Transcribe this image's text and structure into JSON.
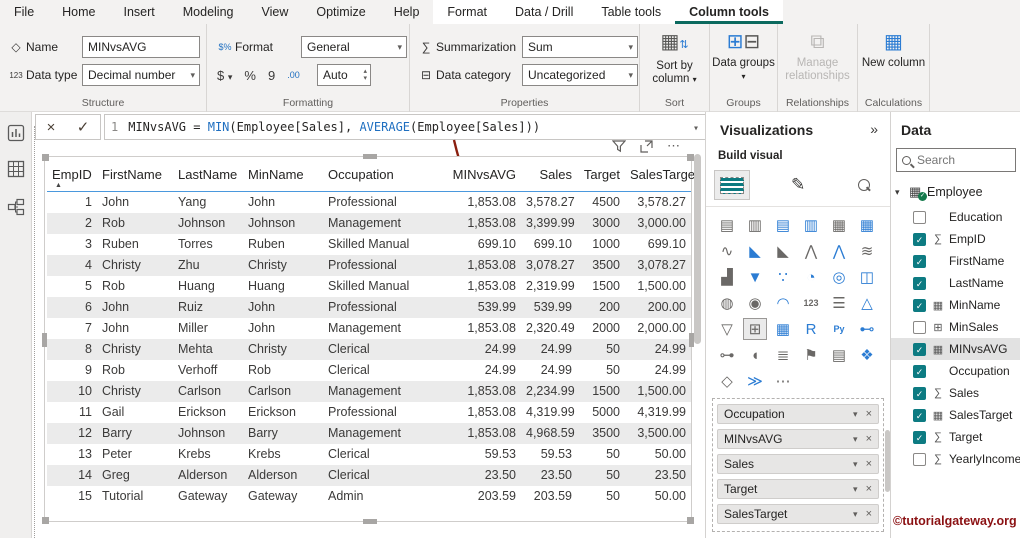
{
  "icons": {
    "chevron_down": "▾",
    "chevron_up": "▴",
    "more": "⋯",
    "double_chevron": "»",
    "check": "✓",
    "close": "×",
    "sort_asc": "▲",
    "tree_chevron": "▾",
    "table_glyph": "▦",
    "name_tag": "◇",
    "datatype_123": "123",
    "format_money": "$%",
    "sigma": "∑",
    "category": "⊟",
    "dollar": "$",
    "percent": "%",
    "thousands": "9",
    "decimals": ".00"
  },
  "menu": {
    "tabs": [
      {
        "dn": "menu-tab-file",
        "label": "File",
        "active": false,
        "ctx": false
      },
      {
        "dn": "menu-tab-home",
        "label": "Home",
        "active": false,
        "ctx": false
      },
      {
        "dn": "menu-tab-insert",
        "label": "Insert",
        "active": false,
        "ctx": false
      },
      {
        "dn": "menu-tab-modeling",
        "label": "Modeling",
        "active": false,
        "ctx": false
      },
      {
        "dn": "menu-tab-view",
        "label": "View",
        "active": false,
        "ctx": false
      },
      {
        "dn": "menu-tab-optimize",
        "label": "Optimize",
        "active": false,
        "ctx": false
      },
      {
        "dn": "menu-tab-help",
        "label": "Help",
        "active": false,
        "ctx": false
      },
      {
        "dn": "menu-tab-format",
        "label": "Format",
        "active": false,
        "ctx": true
      },
      {
        "dn": "menu-tab-data-drill",
        "label": "Data / Drill",
        "active": false,
        "ctx": true
      },
      {
        "dn": "menu-tab-table-tools",
        "label": "Table tools",
        "active": false,
        "ctx": true
      },
      {
        "dn": "menu-tab-column-tools",
        "label": "Column tools",
        "active": true,
        "ctx": true
      }
    ]
  },
  "ribbon": {
    "structure": {
      "name_label": "Name",
      "name_value": "MINvsAVG",
      "datatype_label": "Data type",
      "datatype_value": "Decimal number",
      "group_label": "Structure"
    },
    "formatting": {
      "format_label": "Format",
      "format_value": "General",
      "auto_value": "Auto",
      "group_label": "Formatting"
    },
    "properties": {
      "summarization_label": "Summarization",
      "summarization_value": "Sum",
      "category_label": "Data category",
      "category_value": "Uncategorized",
      "group_label": "Properties"
    },
    "sort": {
      "button_label": "Sort by column",
      "group_label": "Sort"
    },
    "groups": {
      "button_label": "Data groups",
      "group_label": "Groups"
    },
    "relationships": {
      "button_label": "Manage relationships",
      "group_label": "Relationships"
    },
    "calculations": {
      "button_label": "New column",
      "group_label": "Calculations"
    }
  },
  "formula_bar": {
    "line_number": "1",
    "tokens": [
      {
        "text": "MINvsAVG = ",
        "func": false
      },
      {
        "text": "MIN",
        "func": true
      },
      {
        "text": "(Employee[Sales], ",
        "func": false
      },
      {
        "text": "AVERAGE",
        "func": true
      },
      {
        "text": "(Employee[Sales]))",
        "func": false
      }
    ]
  },
  "table": {
    "columns": [
      {
        "dn": "column-header-empid",
        "label": "EmpID",
        "right": false,
        "sorted": true
      },
      {
        "dn": "column-header-firstname",
        "label": "FirstName",
        "right": false,
        "sorted": false
      },
      {
        "dn": "column-header-lastname",
        "label": "LastName",
        "right": false,
        "sorted": false
      },
      {
        "dn": "column-header-minname",
        "label": "MinName",
        "right": false,
        "sorted": false
      },
      {
        "dn": "column-header-occupation",
        "label": "Occupation",
        "right": false,
        "sorted": false
      },
      {
        "dn": "column-header-minvsavg",
        "label": "MINvsAVG",
        "right": true,
        "sorted": false
      },
      {
        "dn": "column-header-sales",
        "label": "Sales",
        "right": true,
        "sorted": false
      },
      {
        "dn": "column-header-target",
        "label": "Target",
        "right": true,
        "sorted": false
      },
      {
        "dn": "column-header-salestarget",
        "label": "SalesTarget",
        "right": true,
        "sorted": false
      }
    ],
    "rows": [
      {
        "empid": "1",
        "first": "John",
        "last": "Yang",
        "minname": "John",
        "occ": "Professional",
        "minvsavg": "1,853.08",
        "sales": "3,578.27",
        "target": "4500",
        "salestarget": "3,578.27"
      },
      {
        "empid": "2",
        "first": "Rob",
        "last": "Johnson",
        "minname": "Johnson",
        "occ": "Management",
        "minvsavg": "1,853.08",
        "sales": "3,399.99",
        "target": "3000",
        "salestarget": "3,000.00"
      },
      {
        "empid": "3",
        "first": "Ruben",
        "last": "Torres",
        "minname": "Ruben",
        "occ": "Skilled Manual",
        "minvsavg": "699.10",
        "sales": "699.10",
        "target": "1000",
        "salestarget": "699.10"
      },
      {
        "empid": "4",
        "first": "Christy",
        "last": "Zhu",
        "minname": "Christy",
        "occ": "Professional",
        "minvsavg": "1,853.08",
        "sales": "3,078.27",
        "target": "3500",
        "salestarget": "3,078.27"
      },
      {
        "empid": "5",
        "first": "Rob",
        "last": "Huang",
        "minname": "Huang",
        "occ": "Skilled Manual",
        "minvsavg": "1,853.08",
        "sales": "2,319.99",
        "target": "1500",
        "salestarget": "1,500.00"
      },
      {
        "empid": "6",
        "first": "John",
        "last": "Ruiz",
        "minname": "John",
        "occ": "Professional",
        "minvsavg": "539.99",
        "sales": "539.99",
        "target": "200",
        "salestarget": "200.00"
      },
      {
        "empid": "7",
        "first": "John",
        "last": "Miller",
        "minname": "John",
        "occ": "Management",
        "minvsavg": "1,853.08",
        "sales": "2,320.49",
        "target": "2000",
        "salestarget": "2,000.00"
      },
      {
        "empid": "8",
        "first": "Christy",
        "last": "Mehta",
        "minname": "Christy",
        "occ": "Clerical",
        "minvsavg": "24.99",
        "sales": "24.99",
        "target": "50",
        "salestarget": "24.99"
      },
      {
        "empid": "9",
        "first": "Rob",
        "last": "Verhoff",
        "minname": "Rob",
        "occ": "Clerical",
        "minvsavg": "24.99",
        "sales": "24.99",
        "target": "50",
        "salestarget": "24.99"
      },
      {
        "empid": "10",
        "first": "Christy",
        "last": "Carlson",
        "minname": "Carlson",
        "occ": "Management",
        "minvsavg": "1,853.08",
        "sales": "2,234.99",
        "target": "1500",
        "salestarget": "1,500.00"
      },
      {
        "empid": "11",
        "first": "Gail",
        "last": "Erickson",
        "minname": "Erickson",
        "occ": "Professional",
        "minvsavg": "1,853.08",
        "sales": "4,319.99",
        "target": "5000",
        "salestarget": "4,319.99"
      },
      {
        "empid": "12",
        "first": "Barry",
        "last": "Johnson",
        "minname": "Barry",
        "occ": "Management",
        "minvsavg": "1,853.08",
        "sales": "4,968.59",
        "target": "3500",
        "salestarget": "3,500.00"
      },
      {
        "empid": "13",
        "first": "Peter",
        "last": "Krebs",
        "minname": "Krebs",
        "occ": "Clerical",
        "minvsavg": "59.53",
        "sales": "59.53",
        "target": "50",
        "salestarget": "50.00"
      },
      {
        "empid": "14",
        "first": "Greg",
        "last": "Alderson",
        "minname": "Alderson",
        "occ": "Clerical",
        "minvsavg": "23.50",
        "sales": "23.50",
        "target": "50",
        "salestarget": "23.50"
      },
      {
        "empid": "15",
        "first": "Tutorial",
        "last": "Gateway",
        "minname": "Gateway",
        "occ": "Admin",
        "minvsavg": "203.59",
        "sales": "203.59",
        "target": "50",
        "salestarget": "50.00"
      }
    ]
  },
  "visualizations": {
    "title": "Visualizations",
    "build_label": "Build visual",
    "icons": [
      {
        "dn": "stacked-bar-chart-icon",
        "glyph": "▤",
        "blue": false,
        "sm": false,
        "sel": false
      },
      {
        "dn": "stacked-column-chart-icon",
        "glyph": "▥",
        "blue": false,
        "sm": false,
        "sel": false
      },
      {
        "dn": "clustered-bar-chart-icon",
        "glyph": "▤",
        "blue": true,
        "sm": false,
        "sel": false
      },
      {
        "dn": "clustered-column-chart-icon",
        "glyph": "▥",
        "blue": true,
        "sm": false,
        "sel": false
      },
      {
        "dn": "hundred-stacked-bar-chart-icon",
        "glyph": "▦",
        "blue": false,
        "sm": false,
        "sel": false
      },
      {
        "dn": "hundred-stacked-column-chart-icon",
        "glyph": "▦",
        "blue": true,
        "sm": false,
        "sel": false
      },
      {
        "dn": "line-chart-icon",
        "glyph": "∿",
        "blue": false,
        "sm": false,
        "sel": false
      },
      {
        "dn": "area-chart-icon",
        "glyph": "◣",
        "blue": true,
        "sm": false,
        "sel": false
      },
      {
        "dn": "stacked-area-chart-icon",
        "glyph": "◣",
        "blue": false,
        "sm": false,
        "sel": false
      },
      {
        "dn": "line-and-stacked-column-chart-icon",
        "glyph": "⋀",
        "blue": false,
        "sm": false,
        "sel": false
      },
      {
        "dn": "line-and-clustered-column-chart-icon",
        "glyph": "⋀",
        "blue": true,
        "sm": false,
        "sel": false
      },
      {
        "dn": "ribbon-chart-icon",
        "glyph": "≋",
        "blue": false,
        "sm": false,
        "sel": false
      },
      {
        "dn": "waterfall-chart-icon",
        "glyph": "▟",
        "blue": false,
        "sm": false,
        "sel": false
      },
      {
        "dn": "funnel-chart-icon",
        "glyph": "▼",
        "blue": true,
        "sm": false,
        "sel": false
      },
      {
        "dn": "scatter-chart-icon",
        "glyph": "∵",
        "blue": true,
        "sm": false,
        "sel": false
      },
      {
        "dn": "pie-chart-icon",
        "glyph": "◔",
        "blue": true,
        "sm": false,
        "sel": false
      },
      {
        "dn": "donut-chart-icon",
        "glyph": "◎",
        "blue": true,
        "sm": false,
        "sel": false
      },
      {
        "dn": "treemap-icon",
        "glyph": "◫",
        "blue": true,
        "sm": false,
        "sel": false
      },
      {
        "dn": "map-icon",
        "glyph": "◍",
        "blue": false,
        "sm": false,
        "sel": false
      },
      {
        "dn": "filled-map-icon",
        "glyph": "◉",
        "blue": false,
        "sm": false,
        "sel": false
      },
      {
        "dn": "gauge-icon",
        "glyph": "◠",
        "blue": true,
        "sm": false,
        "sel": false
      },
      {
        "dn": "card-icon",
        "glyph": "123",
        "blue": false,
        "sm": true,
        "sel": false
      },
      {
        "dn": "multi-row-card-icon",
        "glyph": "☰",
        "blue": false,
        "sm": false,
        "sel": false
      },
      {
        "dn": "kpi-icon",
        "glyph": "△",
        "blue": true,
        "sm": false,
        "sel": false
      },
      {
        "dn": "slicer-icon",
        "glyph": "▽",
        "blue": false,
        "sm": false,
        "sel": false
      },
      {
        "dn": "table-icon",
        "glyph": "⊞",
        "blue": false,
        "sm": false,
        "sel": true
      },
      {
        "dn": "matrix-icon",
        "glyph": "▦",
        "blue": true,
        "sm": false,
        "sel": false
      },
      {
        "dn": "r-script-visual-icon",
        "glyph": "R",
        "blue": true,
        "sm": false,
        "sel": false
      },
      {
        "dn": "python-visual-icon",
        "glyph": "Py",
        "blue": true,
        "sm": true,
        "sel": false
      },
      {
        "dn": "decomposition-tree-icon",
        "glyph": "⊷",
        "blue": true,
        "sm": false,
        "sel": false
      },
      {
        "dn": "key-influencers-icon",
        "glyph": "⊶",
        "blue": false,
        "sm": false,
        "sel": false
      },
      {
        "dn": "qa-visual-icon",
        "glyph": "◖",
        "blue": false,
        "sm": false,
        "sel": false
      },
      {
        "dn": "smart-narrative-icon",
        "glyph": "≣",
        "blue": false,
        "sm": false,
        "sel": false
      },
      {
        "dn": "metrics-icon",
        "glyph": "⚑",
        "blue": false,
        "sm": false,
        "sel": false
      },
      {
        "dn": "paginated-report-icon",
        "glyph": "▤",
        "blue": false,
        "sm": false,
        "sel": false
      },
      {
        "dn": "arcgis-map-icon",
        "glyph": "❖",
        "blue": true,
        "sm": false,
        "sel": false
      },
      {
        "dn": "power-apps-icon",
        "glyph": "◇",
        "blue": false,
        "sm": false,
        "sel": false
      },
      {
        "dn": "power-automate-icon",
        "glyph": "≫",
        "blue": true,
        "sm": false,
        "sel": false
      },
      {
        "dn": "more-visuals-icon",
        "glyph": "⋯",
        "blue": false,
        "sm": false,
        "sel": false
      }
    ],
    "wells": [
      {
        "dn": "well-field-occupation",
        "label": "Occupation"
      },
      {
        "dn": "well-field-minvsavg",
        "label": "MINvsAVG"
      },
      {
        "dn": "well-field-sales",
        "label": "Sales"
      },
      {
        "dn": "well-field-target",
        "label": "Target"
      },
      {
        "dn": "well-field-salestarget",
        "label": "SalesTarget"
      }
    ]
  },
  "data_pane": {
    "title": "Data",
    "search_placeholder": "Search",
    "table_name": "Employee",
    "fields": [
      {
        "dn": "field-education",
        "label": "Education",
        "checked": false,
        "glyph": "",
        "selected": false
      },
      {
        "dn": "field-empid",
        "label": "EmpID",
        "checked": true,
        "glyph": "∑",
        "selected": false
      },
      {
        "dn": "field-firstname",
        "label": "FirstName",
        "checked": true,
        "glyph": "",
        "selected": false
      },
      {
        "dn": "field-lastname",
        "label": "LastName",
        "checked": true,
        "glyph": "",
        "selected": false
      },
      {
        "dn": "field-minname",
        "label": "MinName",
        "checked": true,
        "glyph": "▦",
        "selected": false
      },
      {
        "dn": "field-minsales",
        "label": "MinSales",
        "checked": false,
        "glyph": "⊞",
        "selected": false
      },
      {
        "dn": "field-minvsavg",
        "label": "MINvsAVG",
        "checked": true,
        "glyph": "▦",
        "selected": true
      },
      {
        "dn": "field-occupation",
        "label": "Occupation",
        "checked": true,
        "glyph": "",
        "selected": false
      },
      {
        "dn": "field-sales",
        "label": "Sales",
        "checked": true,
        "glyph": "∑",
        "selected": false
      },
      {
        "dn": "field-salestarget",
        "label": "SalesTarget",
        "checked": true,
        "glyph": "▦",
        "selected": false
      },
      {
        "dn": "field-target",
        "label": "Target",
        "checked": true,
        "glyph": "∑",
        "selected": false
      },
      {
        "dn": "field-yearlyincome",
        "label": "YearlyIncome",
        "checked": false,
        "glyph": "∑",
        "selected": false
      }
    ]
  },
  "watermark": "©tutorialgateway.org"
}
